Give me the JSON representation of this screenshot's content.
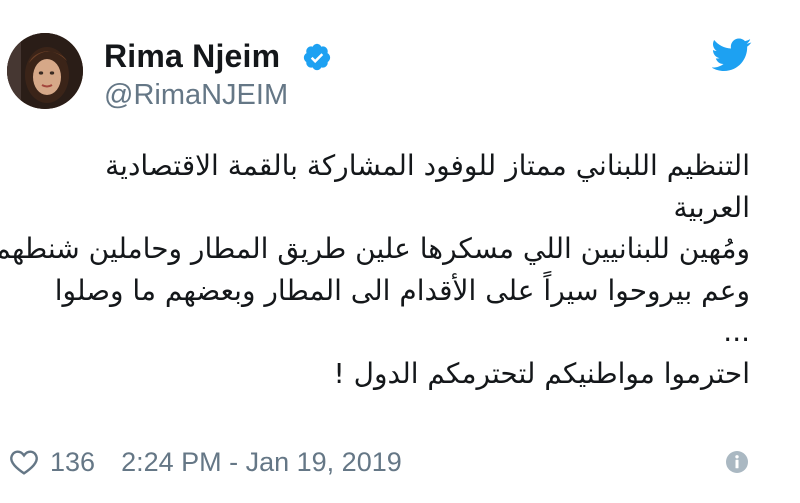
{
  "user": {
    "display_name": "Rima Njeim",
    "handle": "@RimaNJEIM",
    "verified": true
  },
  "tweet": {
    "lines": [
      "التنظيم اللبناني ممتاز للوفود المشاركة بالقمة الاقتصادية",
      "العربية",
      "ومُهين للبنانيين اللي مسكرها علين طريق المطار وحاملين شنطهم",
      "وعم بيروحوا  سيراً على الأقدام الى المطار وبعضهم ما وصلوا",
      "...",
      "احترموا مواطنيكم لتحترمكم الدول !"
    ]
  },
  "footer": {
    "like_count": "136",
    "timestamp": "2:24 PM - Jan 19, 2019"
  },
  "icons": {
    "brand": "twitter-bird-icon",
    "verified": "verified-badge-icon",
    "like": "heart-icon",
    "info": "info-icon"
  },
  "colors": {
    "twitter_blue": "#1da1f2",
    "name_text": "#14171a",
    "secondary_text": "#657786",
    "info_icon": "#aab8c2"
  }
}
